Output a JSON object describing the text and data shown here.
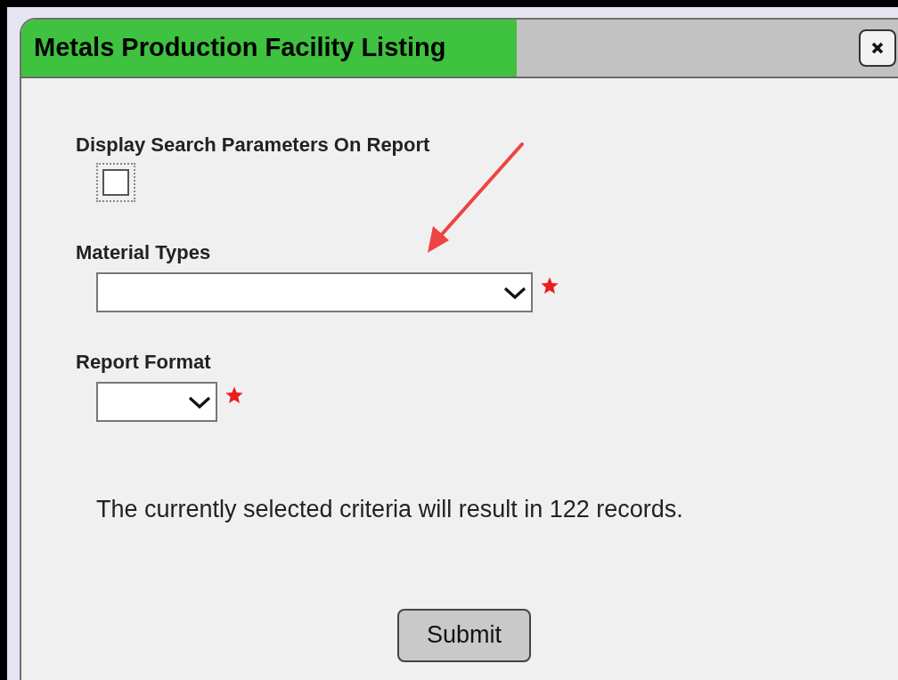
{
  "window": {
    "title": "Metals Production Facility Listing"
  },
  "fields": [
    {
      "kind": "checkbox",
      "label": "Display Search Parameters On Report",
      "checked": false
    },
    {
      "kind": "wide-select",
      "label": "Material Types",
      "required": true,
      "annotated": true
    },
    {
      "kind": "narrow-select",
      "label": "Report Format",
      "required": true,
      "annotated": false
    }
  ],
  "message": "The currently selected criteria will result in 122 records.",
  "submit": "Submit"
}
